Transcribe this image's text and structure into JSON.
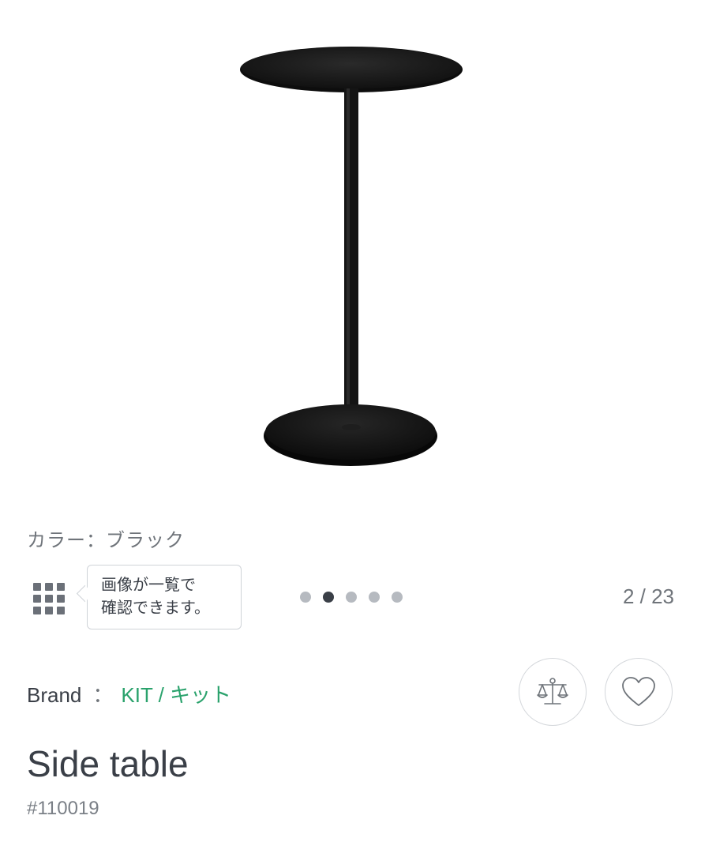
{
  "product": {
    "image_icon": "side-table-image",
    "color_label": "カラー：ブラック",
    "title": "Side table",
    "id": "#110019"
  },
  "gallery": {
    "grid_icon": "grid-icon",
    "tooltip_line1": "画像が一覧で",
    "tooltip_line2": "確認できます。",
    "dots_total_visible": 5,
    "active_dot": 2,
    "counter": "2 / 23"
  },
  "brand": {
    "label": "Brand",
    "separator": "：",
    "name": "KIT / キット",
    "link_color": "#2aa26c"
  },
  "actions": {
    "compare_icon": "scale-icon",
    "favorite_icon": "heart-icon"
  }
}
